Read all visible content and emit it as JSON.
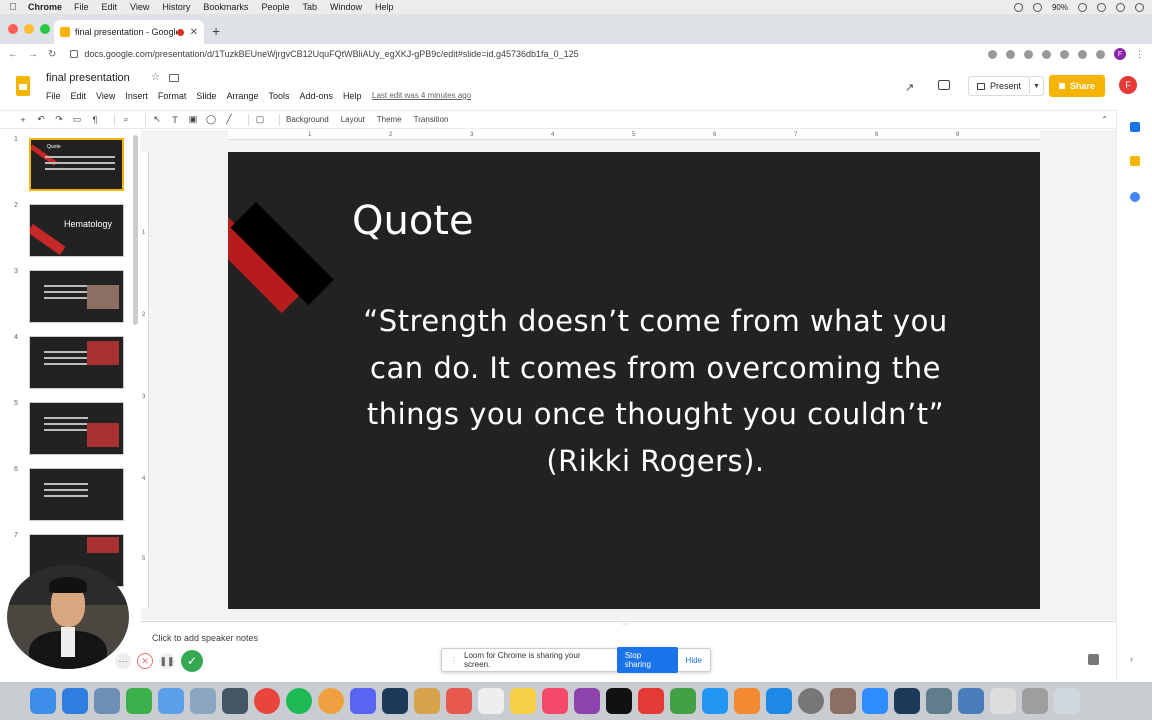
{
  "mac": {
    "app_name": "Chrome",
    "menus": [
      "File",
      "Edit",
      "View",
      "History",
      "Bookmarks",
      "People",
      "Tab",
      "Window",
      "Help"
    ],
    "battery": "90%"
  },
  "browser": {
    "tab_title": "final presentation - Google",
    "url": "docs.google.com/presentation/d/1TuzkBEUneWjrgvCB12UquFQtWBliAUy_egXKJ-gPB9c/edit#slide=id.g45736db1fa_0_125",
    "profile_initial": "F"
  },
  "doc": {
    "title": "final presentation",
    "menus": [
      "File",
      "Edit",
      "View",
      "Insert",
      "Format",
      "Slide",
      "Arrange",
      "Tools",
      "Add-ons",
      "Help"
    ],
    "last_edit": "Last edit was 4 minutes ago",
    "present_label": "Present",
    "share_label": "Share",
    "avatar_initial": "F"
  },
  "toolbar": {
    "background": "Background",
    "layout": "Layout",
    "theme": "Theme",
    "transition": "Transition"
  },
  "filmstrip": [
    {
      "num": "1",
      "title": "Quote",
      "selected": true
    },
    {
      "num": "2",
      "title": "Hematology",
      "selected": false
    },
    {
      "num": "3",
      "title": "",
      "selected": false
    },
    {
      "num": "4",
      "title": "",
      "selected": false
    },
    {
      "num": "5",
      "title": "",
      "selected": false
    },
    {
      "num": "6",
      "title": "",
      "selected": false
    },
    {
      "num": "7",
      "title": "",
      "selected": false
    }
  ],
  "ruler": {
    "h": [
      "1",
      "2",
      "3",
      "4",
      "5",
      "6",
      "7",
      "8",
      "9"
    ],
    "v": [
      "1",
      "2",
      "3",
      "4",
      "5"
    ]
  },
  "slide": {
    "title": "Quote",
    "quote": "“Strength doesn’t come from what you can do. It comes from overcoming the things you once thought you couldn’t” (Rikki Rogers)."
  },
  "notes": {
    "placeholder": "Click to add speaker notes"
  },
  "loom": {
    "message": "Loom for Chrome is sharing your screen.",
    "stop": "Stop sharing",
    "hide": "Hide"
  },
  "colors": {
    "accent_yellow": "#f4b400",
    "slide_bg": "#222222",
    "accent_red": "#b71c1c",
    "loom_blue": "#1a73e8"
  }
}
